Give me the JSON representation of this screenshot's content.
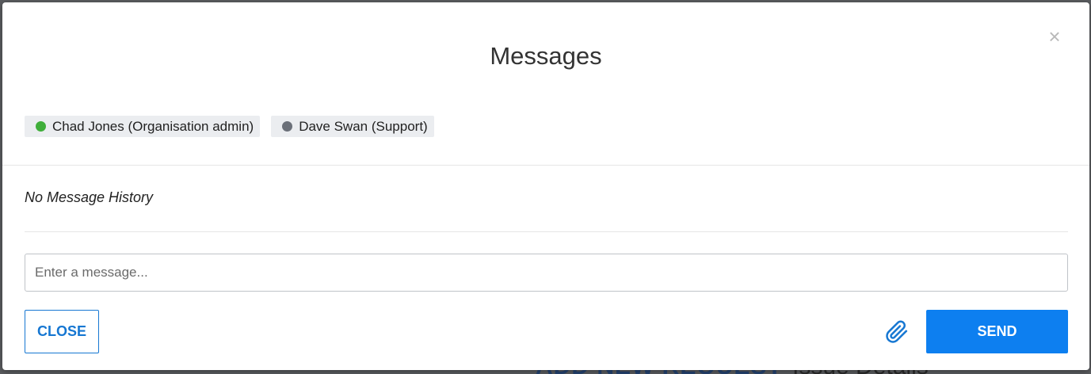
{
  "background": {
    "partial_text_left": "ADD NEW REQUEST",
    "partial_text_right": "Issue Details"
  },
  "modal": {
    "title": "Messages",
    "close_symbol": "×",
    "participants": [
      {
        "name": "Chad Jones (Organisation admin)",
        "status_color": "#3fae3a"
      },
      {
        "name": "Dave Swan (Support)",
        "status_color": "#6b7079"
      }
    ],
    "history_text": "No Message History",
    "message_input": {
      "value": "",
      "placeholder": "Enter a message..."
    },
    "buttons": {
      "close_label": "CLOSE",
      "send_label": "SEND",
      "attach_icon": "paperclip-icon"
    }
  },
  "colors": {
    "primary": "#0d7ff0",
    "close_border": "#1677d2"
  }
}
